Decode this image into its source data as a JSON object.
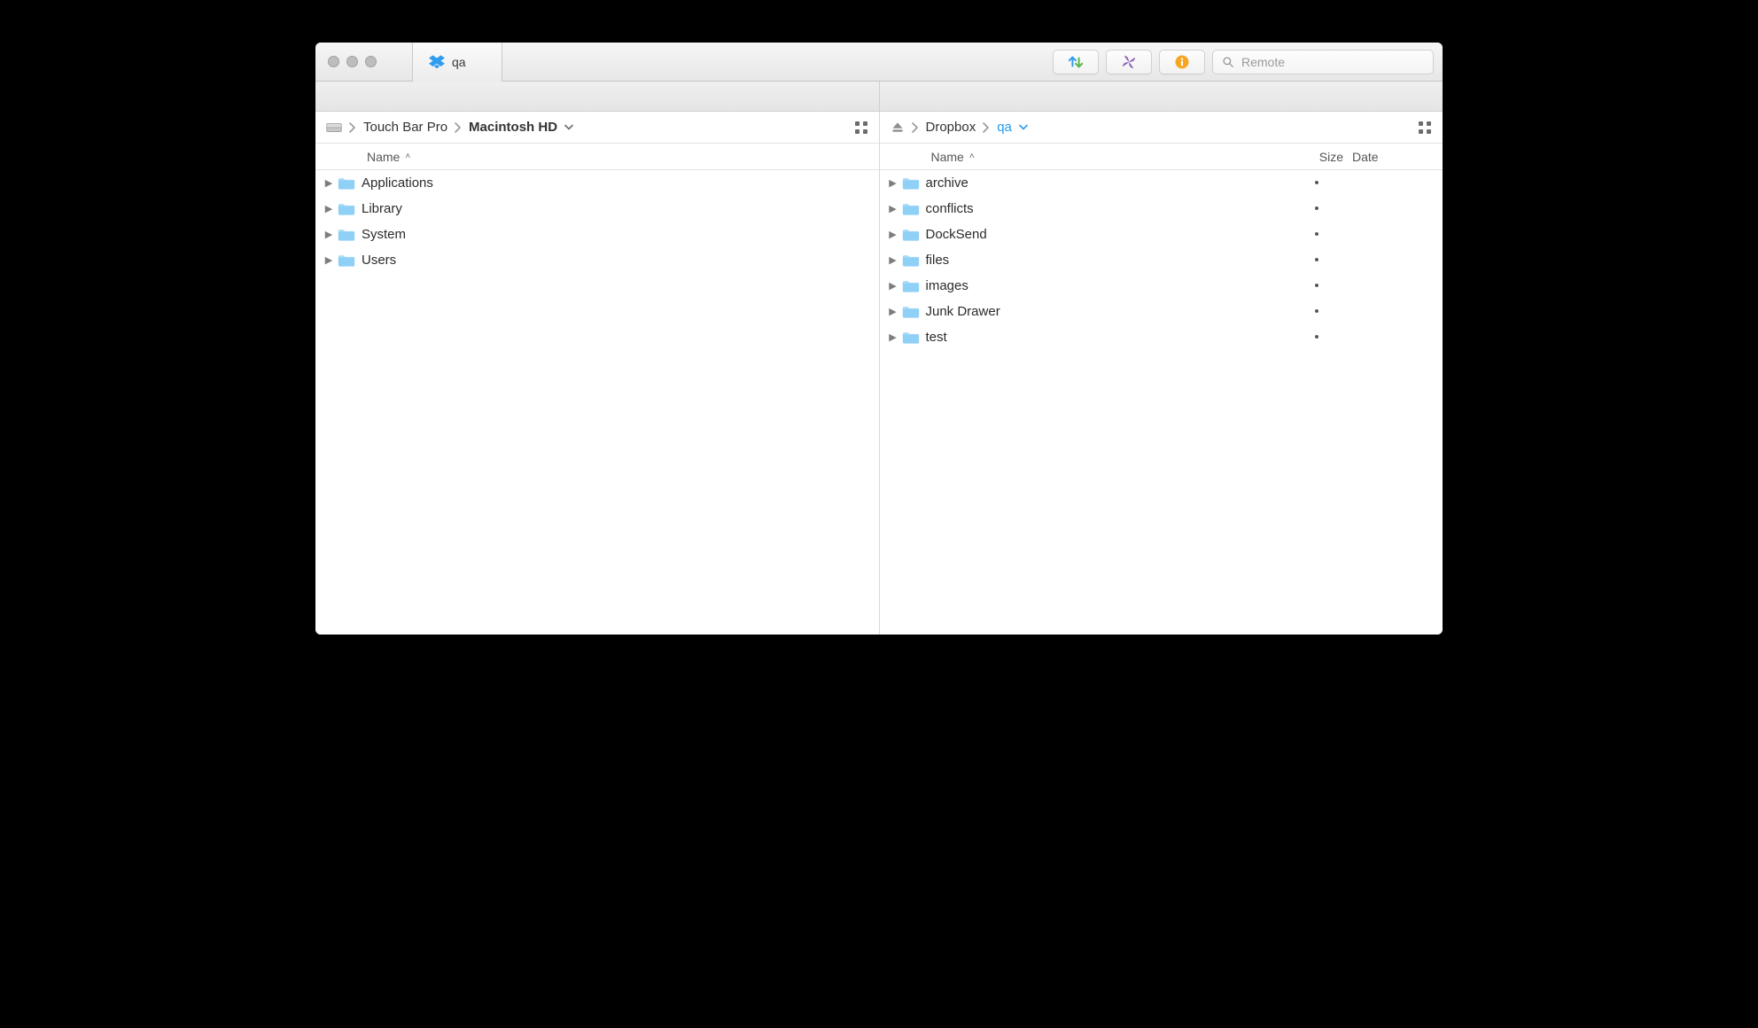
{
  "tab": {
    "title": "qa"
  },
  "search": {
    "placeholder": "Remote"
  },
  "left": {
    "breadcrumb": [
      {
        "label": "Touch Bar Pro",
        "current": false
      },
      {
        "label": "Macintosh HD",
        "current": true
      }
    ],
    "columns": {
      "name": "Name"
    },
    "items": [
      {
        "name": "Applications"
      },
      {
        "name": "Library"
      },
      {
        "name": "System"
      },
      {
        "name": "Users"
      }
    ]
  },
  "right": {
    "breadcrumb": [
      {
        "label": "Dropbox",
        "current": false
      },
      {
        "label": "qa",
        "current": true
      }
    ],
    "columns": {
      "name": "Name",
      "size": "Size",
      "date": "Date"
    },
    "items": [
      {
        "name": "archive",
        "size": "•"
      },
      {
        "name": "conflicts",
        "size": "•"
      },
      {
        "name": "DockSend",
        "size": "•"
      },
      {
        "name": "files",
        "size": "•"
      },
      {
        "name": "images",
        "size": "•"
      },
      {
        "name": "Junk Drawer",
        "size": "•"
      },
      {
        "name": "test",
        "size": "•"
      }
    ]
  }
}
